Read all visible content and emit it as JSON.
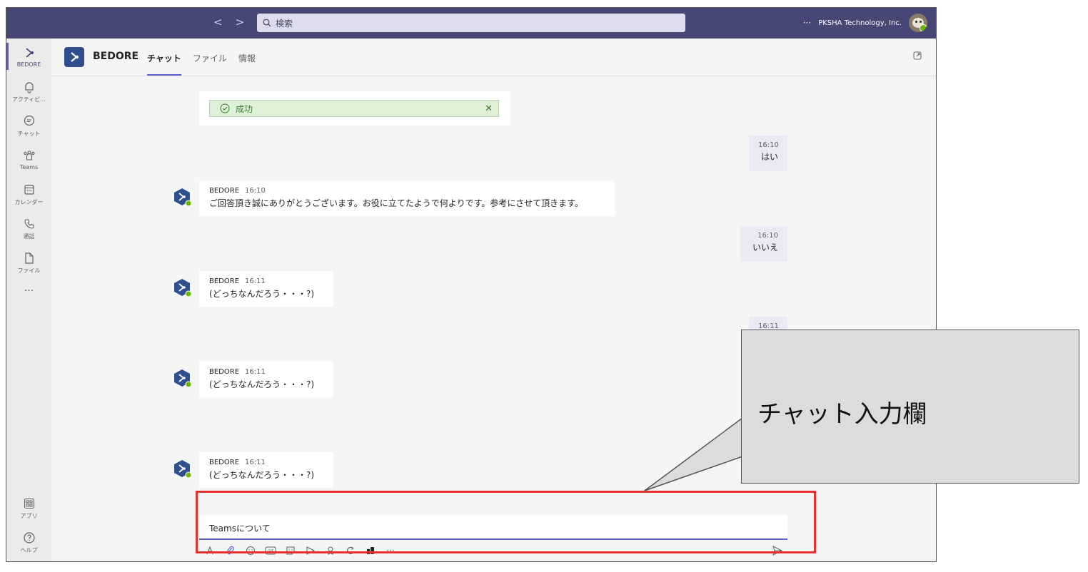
{
  "topbar": {
    "search_placeholder": "検索",
    "more": "···",
    "org_name": "PKSHA Technology, Inc."
  },
  "rail": {
    "items": [
      {
        "label": "BEDORE",
        "icon": "bedore-app-icon"
      },
      {
        "label": "アクティビ...",
        "icon": "bell-icon"
      },
      {
        "label": "チャット",
        "icon": "chat-icon"
      },
      {
        "label": "Teams",
        "icon": "teams-icon"
      },
      {
        "label": "カレンダー",
        "icon": "calendar-icon"
      },
      {
        "label": "通話",
        "icon": "phone-icon"
      },
      {
        "label": "ファイル",
        "icon": "file-icon"
      },
      {
        "label": "···",
        "icon": "more-icon"
      },
      {
        "label": "アプリ",
        "icon": "apps-icon"
      },
      {
        "label": "ヘルプ",
        "icon": "help-icon"
      }
    ]
  },
  "header": {
    "app_name": "BEDORE",
    "tabs": [
      {
        "label": "チャット",
        "active": true
      },
      {
        "label": "ファイル",
        "active": false
      },
      {
        "label": "情報",
        "active": false
      }
    ]
  },
  "success": {
    "text": "成功"
  },
  "messages": [
    {
      "from": "me",
      "time": "16:10",
      "text": "はい"
    },
    {
      "from": "BEDORE",
      "time": "16:10",
      "text": "ご回答頂き誠にありがとうございます。お役に立てたようで何よりです。参考にさせて頂きます。"
    },
    {
      "from": "me",
      "time": "16:10",
      "text": "いいえ"
    },
    {
      "from": "BEDORE",
      "time": "16:11",
      "text": "(どっちなんだろう・・・?)"
    },
    {
      "from": "me",
      "time": "16:11",
      "text": ""
    },
    {
      "from": "BEDORE",
      "time": "16:11",
      "text": "(どっちなんだろう・・・?)"
    },
    {
      "from": "BEDORE",
      "time": "16:11",
      "text": "(どっちなんだろう・・・?)"
    }
  ],
  "compose": {
    "value": "Teamsについて",
    "toolbar_more": "···"
  },
  "callout": {
    "text": "チャット入力欄"
  },
  "colors": {
    "topbar": "#464775",
    "accent": "#5b5fc7",
    "highlight": "#e8312f",
    "success_bg": "#dff0d8"
  }
}
